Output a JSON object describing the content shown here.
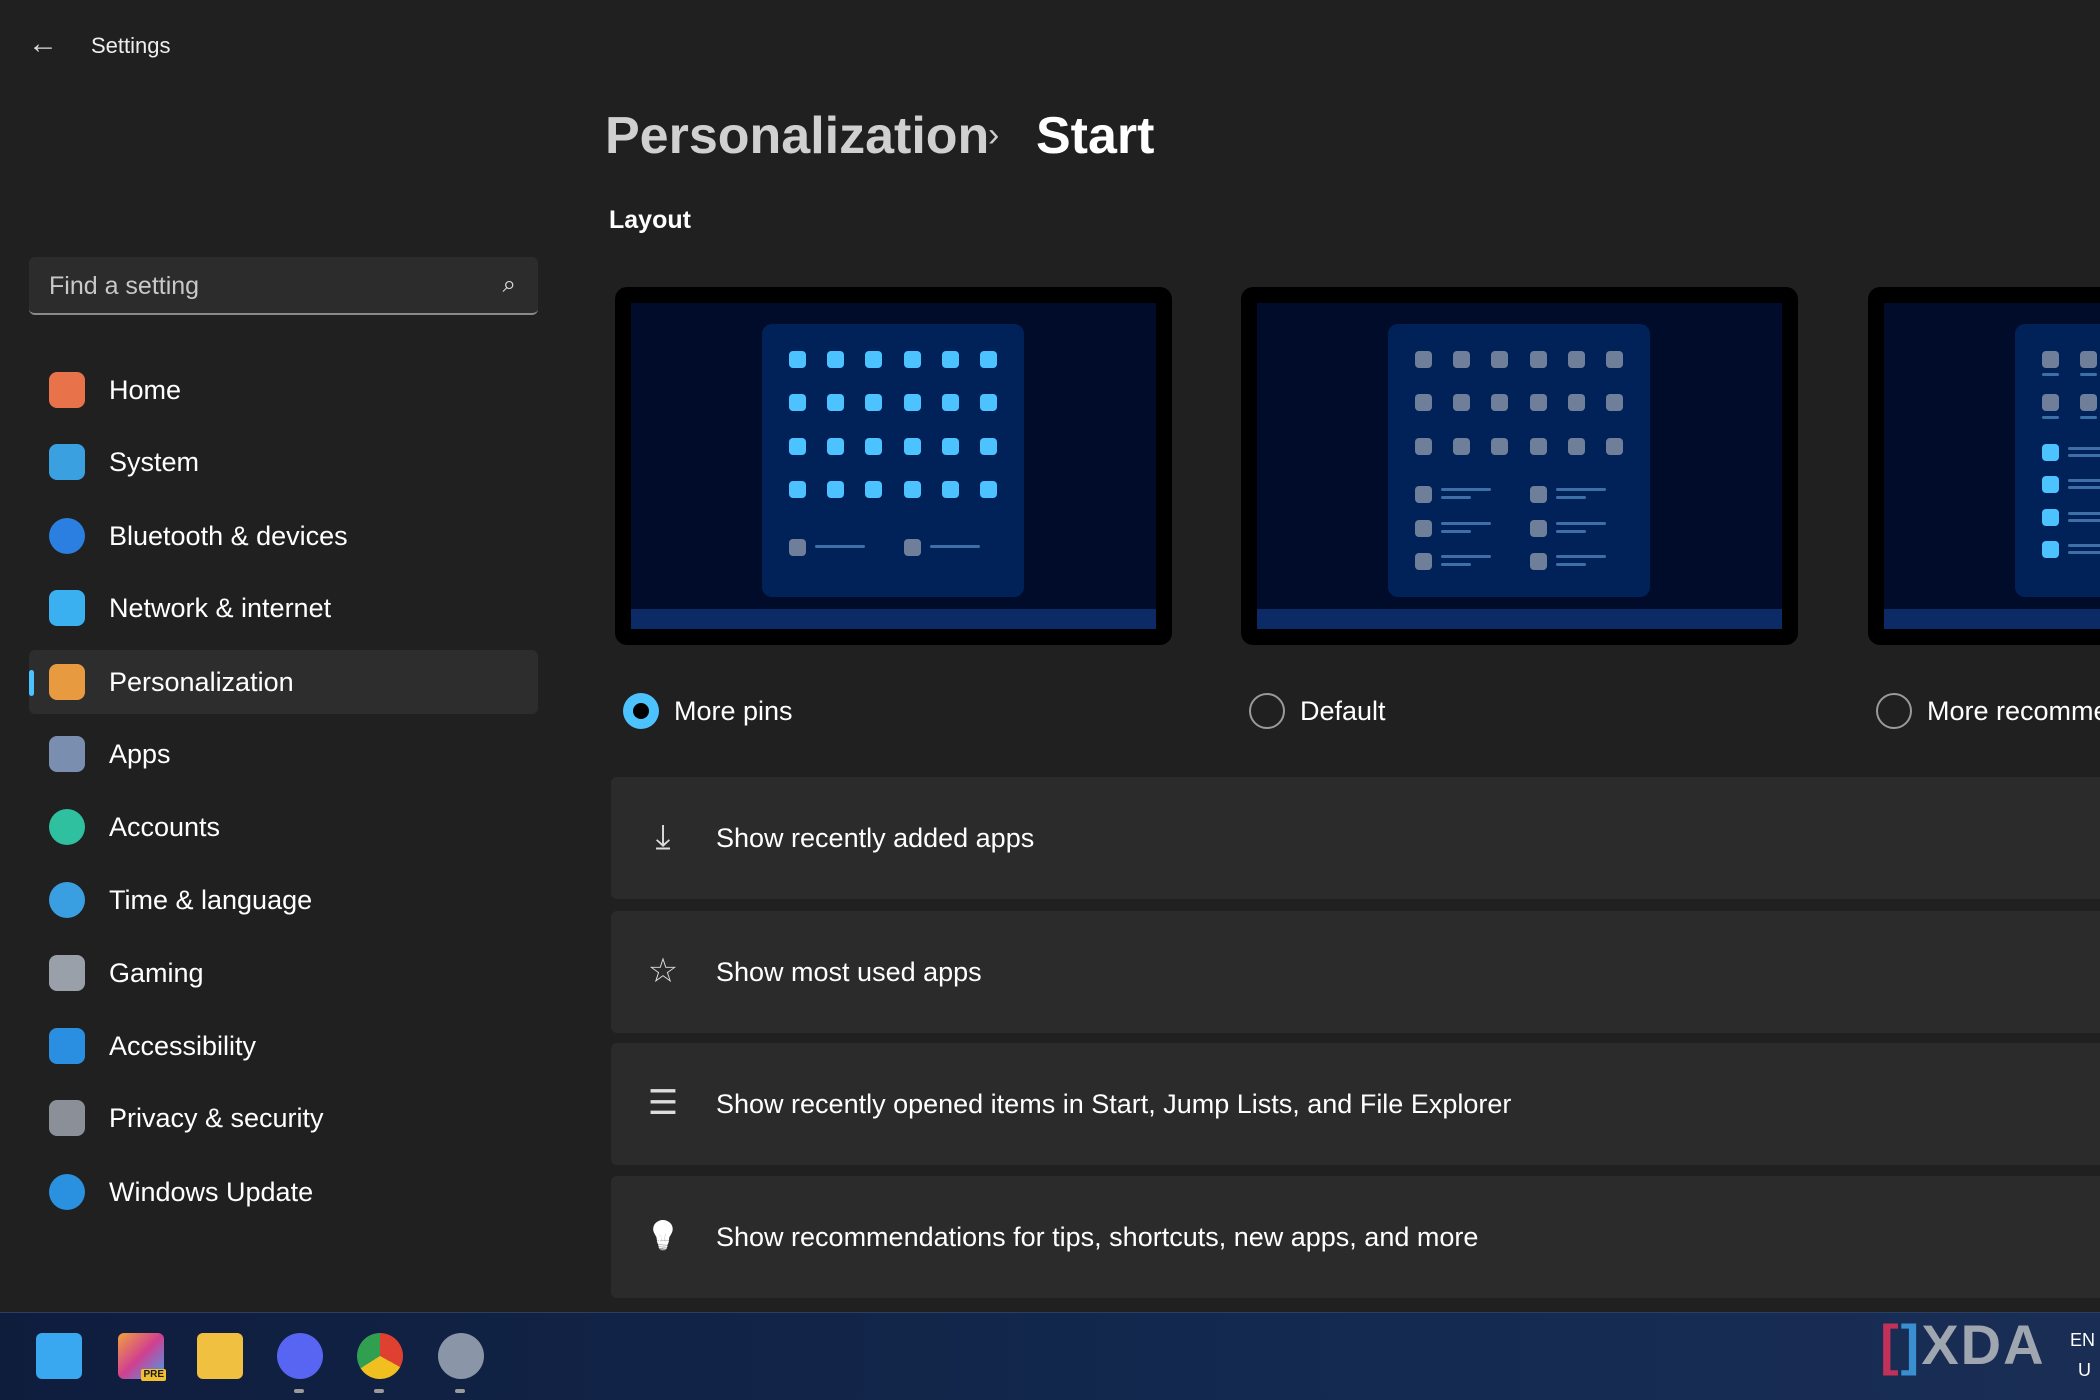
{
  "window": {
    "title": "Settings",
    "back_icon": "arrow-left-icon"
  },
  "search": {
    "placeholder": "Find a setting",
    "icon": "search-icon"
  },
  "sidebar": {
    "items": [
      {
        "label": "Home",
        "icon": "home-icon",
        "color": "#e8734a"
      },
      {
        "label": "System",
        "icon": "monitor-icon",
        "color": "#3aa0e0"
      },
      {
        "label": "Bluetooth & devices",
        "icon": "bluetooth-icon",
        "color": "#2a7fe0"
      },
      {
        "label": "Network & internet",
        "icon": "wifi-icon",
        "color": "#3ab0f0"
      },
      {
        "label": "Personalization",
        "icon": "brush-icon",
        "color": "#e89a40",
        "selected": true
      },
      {
        "label": "Apps",
        "icon": "apps-icon",
        "color": "#7a8fb0"
      },
      {
        "label": "Accounts",
        "icon": "person-icon",
        "color": "#2fc0a0"
      },
      {
        "label": "Time & language",
        "icon": "globe-clock-icon",
        "color": "#3a9fe0"
      },
      {
        "label": "Gaming",
        "icon": "gamepad-icon",
        "color": "#9aa0aa"
      },
      {
        "label": "Accessibility",
        "icon": "accessibility-icon",
        "color": "#2a8fe0"
      },
      {
        "label": "Privacy & security",
        "icon": "shield-icon",
        "color": "#8a8f98"
      },
      {
        "label": "Windows Update",
        "icon": "update-icon",
        "color": "#2a90e0"
      }
    ]
  },
  "breadcrumb": {
    "parent": "Personalization",
    "separator": "›",
    "current": "Start"
  },
  "layout": {
    "heading": "Layout",
    "options": [
      {
        "label": "More pins",
        "selected": true,
        "preview": "more-pins"
      },
      {
        "label": "Default",
        "selected": false,
        "preview": "default"
      },
      {
        "label": "More recomme",
        "selected": false,
        "preview": "more-recommendations"
      }
    ]
  },
  "settings": [
    {
      "label": "Show recently added apps",
      "icon": "download-icon"
    },
    {
      "label": "Show most used apps",
      "icon": "star-icon"
    },
    {
      "label": "Show recently opened items in Start, Jump Lists, and File Explorer",
      "icon": "list-icon"
    },
    {
      "label": "Show recommendations for tips, shortcuts, new apps, and more",
      "icon": "lightbulb-icon"
    }
  ],
  "taskbar": {
    "apps": [
      {
        "name": "start",
        "icon": "windows-logo-icon"
      },
      {
        "name": "copilot",
        "icon": "copilot-pre-icon",
        "badge": "PRE"
      },
      {
        "name": "file-explorer",
        "icon": "folder-icon"
      },
      {
        "name": "discord",
        "icon": "discord-icon"
      },
      {
        "name": "chrome",
        "icon": "chrome-icon"
      },
      {
        "name": "settings",
        "icon": "gear-icon"
      }
    ],
    "lang_top": "EN",
    "lang_bottom": "U"
  },
  "watermark": "XDA",
  "colors": {
    "accent": "#4cc2ff",
    "background": "#202020",
    "card": "#2b2b2b"
  }
}
